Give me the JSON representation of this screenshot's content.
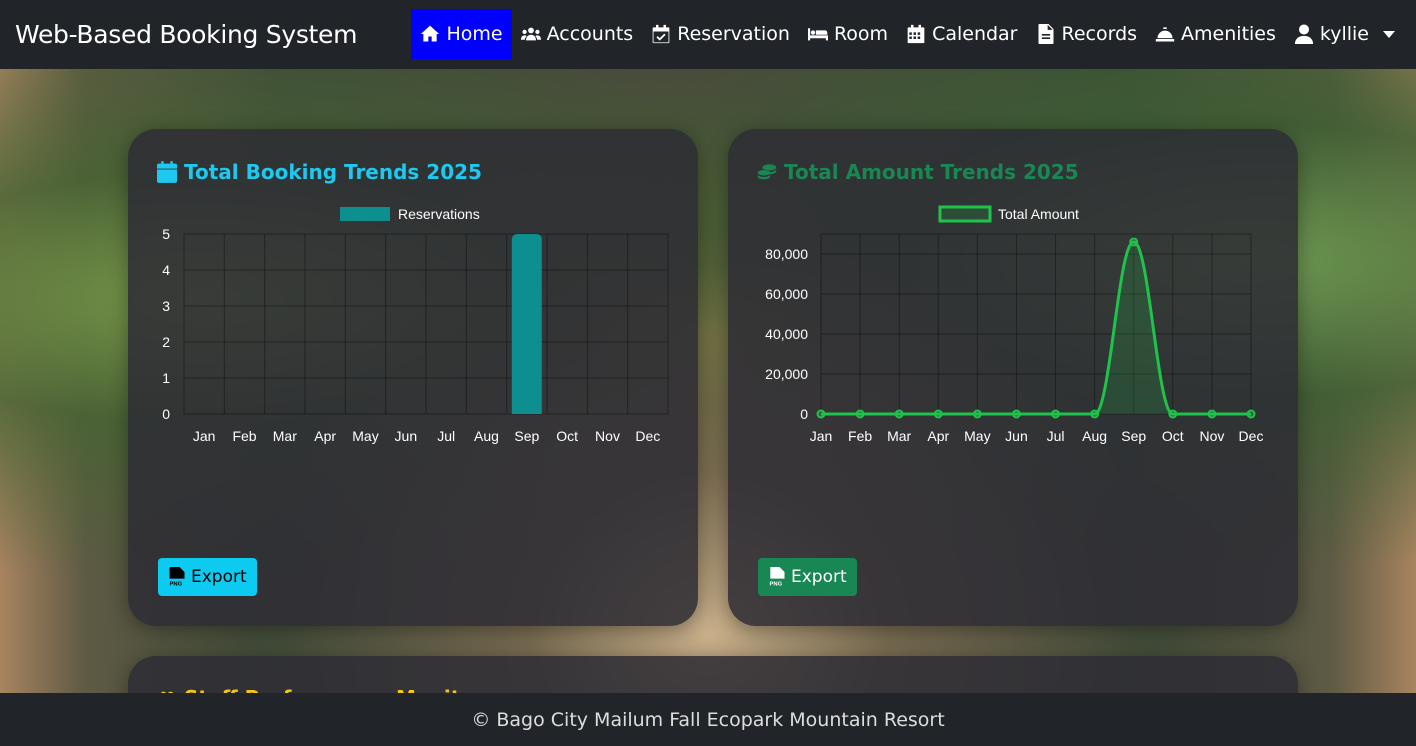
{
  "app": {
    "title": "Web-Based Booking System"
  },
  "nav": {
    "items": [
      {
        "label": "Home",
        "icon": "home-icon",
        "active": true
      },
      {
        "label": "Accounts",
        "icon": "users-icon"
      },
      {
        "label": "Reservation",
        "icon": "calendar-check-icon"
      },
      {
        "label": "Room",
        "icon": "bed-icon"
      },
      {
        "label": "Calendar",
        "icon": "calendar-icon"
      },
      {
        "label": "Records",
        "icon": "file-icon"
      },
      {
        "label": "Amenities",
        "icon": "bell-concierge-icon"
      }
    ],
    "user": {
      "name": "kyllie",
      "icon": "user-icon"
    }
  },
  "booking_card": {
    "title": "Total Booking Trends 2025",
    "icon": "calendar-icon",
    "export_label": "Export",
    "export_icon": "file-png-icon"
  },
  "amount_card": {
    "title": "Total Amount Trends 2025",
    "icon": "coins-icon",
    "export_label": "Export",
    "export_icon": "file-png-icon"
  },
  "staff_card": {
    "title": "Staff Performance Monitor",
    "icon": "users-icon"
  },
  "footer": {
    "text": "© Bago City Mailum Fall Ecopark Mountain Resort"
  },
  "colors": {
    "nav_bg": "#212529",
    "active_nav": "#0000ff",
    "booking_accent": "#1ec8ee",
    "bar_color": "#0d8f8f",
    "amount_accent": "#198754",
    "line_color": "#1fc24a",
    "staff_accent": "#f5c518"
  },
  "chart_data": [
    {
      "type": "bar",
      "title": "",
      "categories": [
        "Jan",
        "Feb",
        "Mar",
        "Apr",
        "May",
        "Jun",
        "Jul",
        "Aug",
        "Sep",
        "Oct",
        "Nov",
        "Dec"
      ],
      "series": [
        {
          "name": "Reservations",
          "values": [
            0,
            0,
            0,
            0,
            0,
            0,
            0,
            0,
            5,
            0,
            0,
            0
          ]
        }
      ],
      "ylim": [
        0,
        5
      ],
      "yticks": [
        "0",
        "1",
        "2",
        "3",
        "4",
        "5"
      ],
      "grid": true,
      "legend": "top-center"
    },
    {
      "type": "line",
      "title": "",
      "categories": [
        "Jan",
        "Feb",
        "Mar",
        "Apr",
        "May",
        "Jun",
        "Jul",
        "Aug",
        "Sep",
        "Oct",
        "Nov",
        "Dec"
      ],
      "series": [
        {
          "name": "Total Amount",
          "values": [
            0,
            0,
            0,
            0,
            0,
            0,
            0,
            0,
            86000,
            0,
            0,
            0
          ]
        }
      ],
      "ylim": [
        0,
        90000
      ],
      "yticks": [
        "0",
        "20,000",
        "40,000",
        "60,000",
        "80,000"
      ],
      "ytick_values": [
        0,
        20000,
        40000,
        60000,
        80000
      ],
      "grid": true,
      "legend": "top-center"
    }
  ]
}
